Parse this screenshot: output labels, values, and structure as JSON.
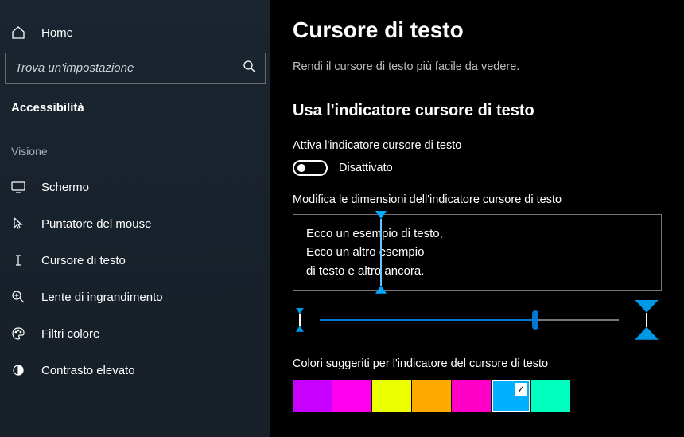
{
  "sidebar": {
    "home": "Home",
    "search_placeholder": "Trova un'impostazione",
    "category": "Accessibilità",
    "group": "Visione",
    "items": [
      {
        "label": "Schermo"
      },
      {
        "label": "Puntatore del mouse"
      },
      {
        "label": "Cursore di testo"
      },
      {
        "label": "Lente di ingrandimento"
      },
      {
        "label": "Filtri colore"
      },
      {
        "label": "Contrasto elevato"
      }
    ]
  },
  "main": {
    "title": "Cursore di testo",
    "description": "Rendi il cursore di testo più facile da vedere.",
    "section_title": "Usa l'indicatore cursore di testo",
    "toggle_label": "Attiva l'indicatore cursore di testo",
    "toggle_state": "Disattivato",
    "size_label": "Modifica le dimensioni dell'indicatore cursore di testo",
    "preview_line1": "Ecco un esempio di testo,",
    "preview_line2": "Ecco un altro esempio",
    "preview_line3": "di testo e altro ancora.",
    "colors_label": "Colori suggeriti per l'indicatore del cursore di testo",
    "colors": [
      {
        "hex": "#c800ff",
        "selected": false
      },
      {
        "hex": "#ff00ee",
        "selected": false
      },
      {
        "hex": "#ecff00",
        "selected": false
      },
      {
        "hex": "#ffaa00",
        "selected": false
      },
      {
        "hex": "#ff00c8",
        "selected": false
      },
      {
        "hex": "#00b0ff",
        "selected": true
      },
      {
        "hex": "#00ffbf",
        "selected": false
      }
    ]
  }
}
